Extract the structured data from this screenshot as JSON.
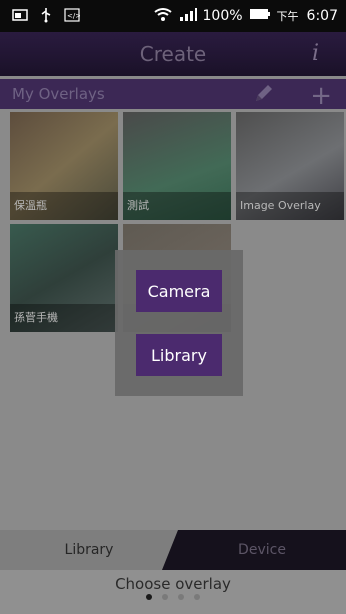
{
  "status_bar": {
    "battery_text": "100%",
    "time": "6:07",
    "time_period": "下午",
    "icons": [
      "usb-icon",
      "wifi-icon",
      "signal-icon",
      "battery-icon",
      "image-icon",
      "code-icon"
    ]
  },
  "header": {
    "title": "Create",
    "info_label": "i"
  },
  "overlays": {
    "title": "My Overlays",
    "add_label": "+",
    "items": [
      {
        "label": "保溫瓶"
      },
      {
        "label": "測試"
      },
      {
        "label": "Image Overlay"
      },
      {
        "label": "孫菅手機"
      },
      {
        "label": ""
      }
    ]
  },
  "modal": {
    "camera_label": "Camera",
    "library_label": "Library"
  },
  "bottom": {
    "tab_library": "Library",
    "tab_device": "Device",
    "hint": "Choose overlay",
    "page_dots": 4,
    "active_page": 0
  },
  "colors": {
    "accent": "#4b2a6e",
    "header_bg": "#2a1b3f",
    "overlay_bar": "#3c2855"
  }
}
